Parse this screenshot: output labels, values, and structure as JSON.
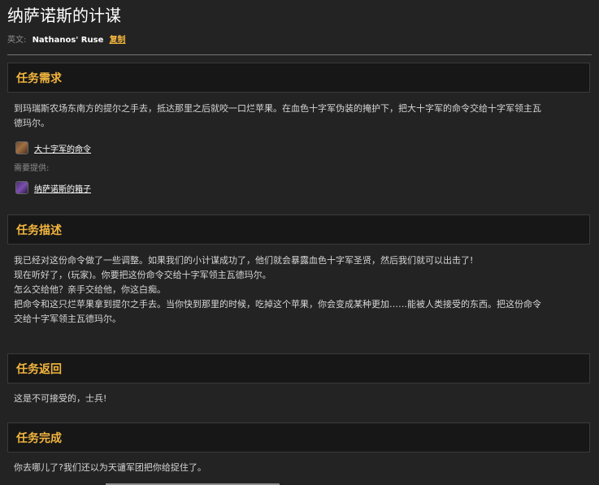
{
  "page": {
    "title": "纳萨诺斯的计谋",
    "english_label": "英文:",
    "english_name": "Nathanos' Ruse",
    "copy_label": "复制"
  },
  "sections": {
    "requirements": {
      "heading": "任务需求",
      "paragraph_lines": [
        "到玛瑞斯农场东南方的提尔之手去，抵达那里之后就咬一口烂苹果。在血色十字军伪装的掩护下，把大十字军的命令交给十字军领主瓦",
        "德玛尔。"
      ],
      "item_link": "大十字军的命令",
      "needs_label": "需要提供:",
      "provided_item_link": "纳萨诺斯的箱子"
    },
    "description": {
      "heading": "任务描述",
      "lines": [
        "我已经对这份命令做了一些调整。如果我们的小计谋成功了，他们就会暴露血色十字军圣贤，然后我们就可以出击了!",
        "现在听好了，(玩家)。你要把这份命令交给十字军领主瓦德玛尔。",
        "怎么交给他？亲手交给他，你这白痴。",
        "把命令和这只烂苹果拿到提尔之手去。当你快到那里的时候，吃掉这个苹果，你会变成某种更加……能被人类接受的东西。把这份命令",
        "交给十字军领主瓦德玛尔。"
      ]
    },
    "return": {
      "heading": "任务返回",
      "text": "这是不可接受的，士兵!"
    },
    "complete": {
      "heading": "任务完成",
      "text": "你去哪儿了?我们还以为天谴军团把你给捉住了。"
    }
  },
  "colors": {
    "accent": "#f2b53e",
    "background": "#232323",
    "header_bg": "#171717"
  },
  "icons": {
    "item_icon": "scroll-icon",
    "provided_icon": "box-icon"
  }
}
